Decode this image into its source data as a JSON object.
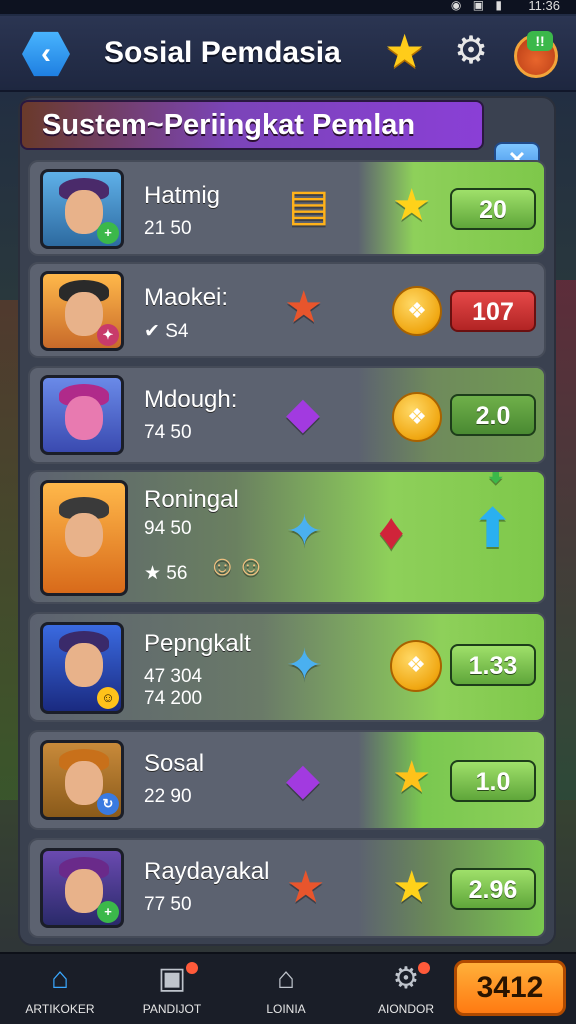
{
  "status": {
    "time": "11:36",
    "icons": "◉ ▣ ▮"
  },
  "header": {
    "title": "Sosial Pemdasia",
    "back_icon": "back-arrow-icon",
    "star_icon": "star-icon",
    "settings_icon": "gear-icon",
    "gift_badge": "!!"
  },
  "banner": {
    "text": "Sustem~Periingkat Pemlan",
    "action_glyph": "✕"
  },
  "rows": [
    {
      "name": "Hatmig",
      "sub": "21 50",
      "score": "20",
      "score_style": "green"
    },
    {
      "name": "Maokei:",
      "sub": "✔ S4",
      "score": "107",
      "score_style": "red"
    },
    {
      "name": "Mdough:",
      "sub": "74 50",
      "score": "2.0",
      "score_style": "green"
    },
    {
      "name": "Roningal",
      "sub": "94 50",
      "sub2": "★ 56",
      "score": "",
      "score_style": "none"
    },
    {
      "name": "Pepngkalt",
      "sub": "47 304",
      "sub2": "74 200",
      "score": "1.33",
      "score_style": "green"
    },
    {
      "name": "Sosal",
      "sub": "22 90",
      "score": "1.0",
      "score_style": "green"
    },
    {
      "name": "Raydayakal",
      "sub": "77 50",
      "score": "2.96",
      "score_style": "green"
    }
  ],
  "nav": [
    {
      "label": "ARTIKOKER",
      "icon": "home-icon"
    },
    {
      "label": "PANDIJOT",
      "icon": "inbox-icon"
    },
    {
      "label": "LOINIA",
      "icon": "shop-icon"
    },
    {
      "label": "AIONDOR",
      "icon": "gear-icon"
    }
  ],
  "cta": {
    "label": "3412"
  },
  "colors": {
    "accent_green": "#7ed04b",
    "accent_red": "#d23a3a",
    "cta_orange": "#ff8a1a",
    "banner_purple": "#8a3fd6"
  }
}
